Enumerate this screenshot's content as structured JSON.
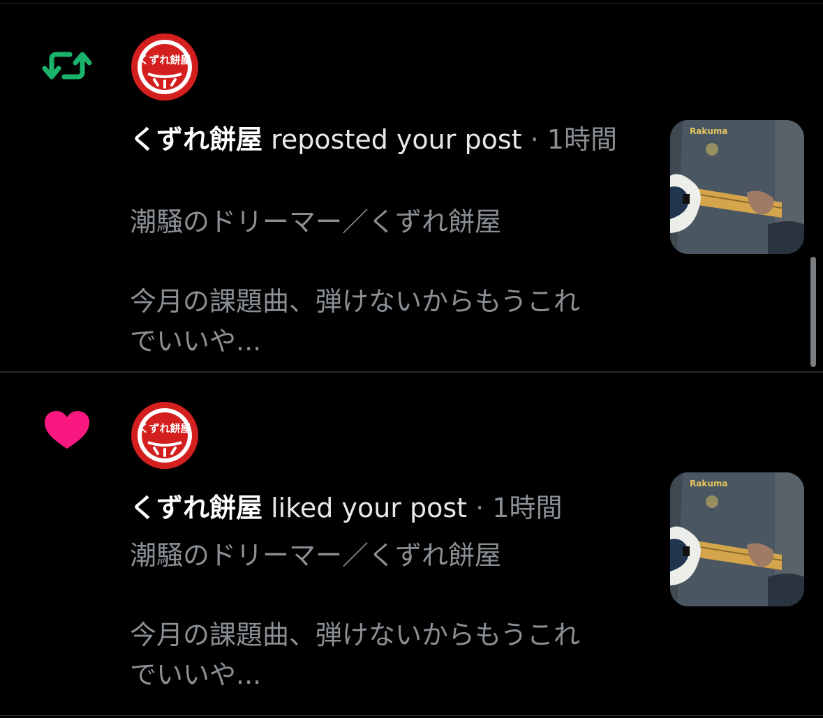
{
  "notifications": [
    {
      "type": "repost",
      "action_icon": "repost-icon",
      "action_color": "#19b36b",
      "avatar_text": "くずれ餅屋",
      "user_name": "くずれ餅屋",
      "action_text": "reposted your post",
      "meta_separator": " · ",
      "time": "1時間",
      "post_title": "潮騒のドリーマー／くずれ餅屋",
      "post_body_line1": "今月の課題曲、弾けないからもうこれ",
      "post_body_line2": "でいいや...",
      "thumbnail": "guitar-player-photo",
      "thumbnail_caption": "Rakuma"
    },
    {
      "type": "like",
      "action_icon": "heart-icon",
      "action_color": "#f91880",
      "avatar_text": "くずれ餅屋",
      "user_name": "くずれ餅屋",
      "action_text": "liked your post",
      "meta_separator": " · ",
      "time": "1時間",
      "post_title": "潮騒のドリーマー／くずれ餅屋",
      "post_body_line1": "今月の課題曲、弾けないからもうこれ",
      "post_body_line2": "でいいや...",
      "thumbnail": "guitar-player-photo",
      "thumbnail_caption": "Rakuma"
    }
  ],
  "colors": {
    "background": "#000000",
    "primary_text": "#e7e9ea",
    "secondary_text": "#8b9095",
    "divider": "#262a2e",
    "avatar_red": "#d41f1f"
  }
}
